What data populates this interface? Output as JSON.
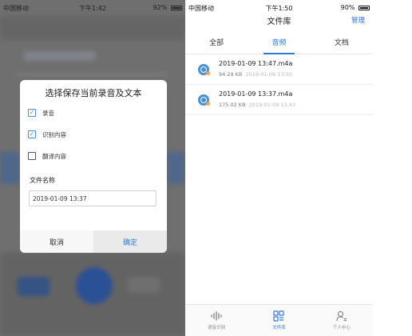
{
  "left": {
    "status": {
      "carrier": "中国移动",
      "time": "下午1:42",
      "battery": "92%",
      "battery_level": 0.92
    },
    "dialog": {
      "title": "选择保存当前录音及文本",
      "options": [
        {
          "label": "录音",
          "checked": true
        },
        {
          "label": "识别内容",
          "checked": true
        },
        {
          "label": "翻译内容",
          "checked": false
        }
      ],
      "filename_label": "文件名称",
      "filename_value": "2019-01-09 13:37",
      "cancel": "取消",
      "confirm": "确定"
    }
  },
  "right": {
    "status": {
      "carrier": "中国移动",
      "time": "下午1:50",
      "battery": "90%",
      "battery_level": 0.9
    },
    "nav": {
      "title": "文件库",
      "manage": "管理"
    },
    "tabs": [
      {
        "label": "全部",
        "active": false
      },
      {
        "label": "音频",
        "active": true
      },
      {
        "label": "文档",
        "active": false
      }
    ],
    "files": [
      {
        "name": "2019-01-09 13:47.m4a",
        "size": "94.29 KB",
        "time": "2019-01-09 13:50"
      },
      {
        "name": "2019-01-09 13:37.m4a",
        "size": "175.02 KB",
        "time": "2019-01-09 13:43"
      }
    ],
    "bottom_nav": [
      {
        "label": "语音识别",
        "icon": "waveform-icon",
        "active": false
      },
      {
        "label": "文件库",
        "icon": "grid-icon",
        "active": true
      },
      {
        "label": "个人中心",
        "icon": "person-icon",
        "active": false
      }
    ]
  },
  "colors": {
    "accent": "#2d79d6",
    "file_icon": "#4a90d9",
    "file_icon_dot": "#f0a640"
  }
}
